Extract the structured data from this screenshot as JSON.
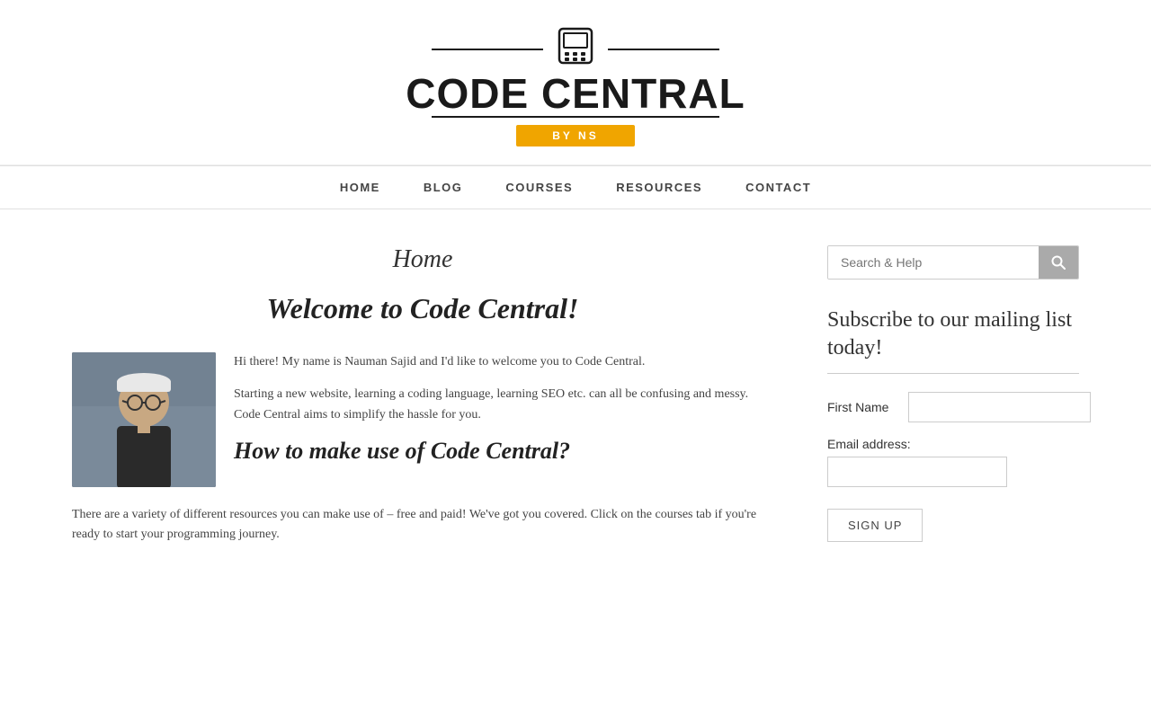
{
  "header": {
    "logo_text": "CODE CENTRAL",
    "logo_byline": "BY NS"
  },
  "nav": {
    "items": [
      {
        "label": "HOME",
        "href": "#"
      },
      {
        "label": "BLOG",
        "href": "#"
      },
      {
        "label": "COURSES",
        "href": "#"
      },
      {
        "label": "RESOURCES",
        "href": "#"
      },
      {
        "label": "CONTACT",
        "href": "#"
      }
    ]
  },
  "main": {
    "page_title": "Home",
    "welcome_heading": "Welcome to Code Central!",
    "intro_paragraph_1": "Hi there! My name is Nauman Sajid and I'd like to welcome you to Code Central.",
    "intro_paragraph_2": "Starting a new website, learning a coding language, learning SEO etc. can all be confusing and messy. Code Central aims to simplify the hassle for you.",
    "section_heading": "How to make use of Code Central?",
    "body_text_1": "There are a variety of different resources you can make use of – free and paid! We've got you covered. Click on the courses tab if you're ready to start your programming journey."
  },
  "sidebar": {
    "search_placeholder": "Search & Help",
    "search_button_icon": "search-icon",
    "mailing_title": "Subscribe to our mailing list today!",
    "first_name_label": "First Name",
    "email_label": "Email address:",
    "signup_button_label": "SIGN UP"
  }
}
